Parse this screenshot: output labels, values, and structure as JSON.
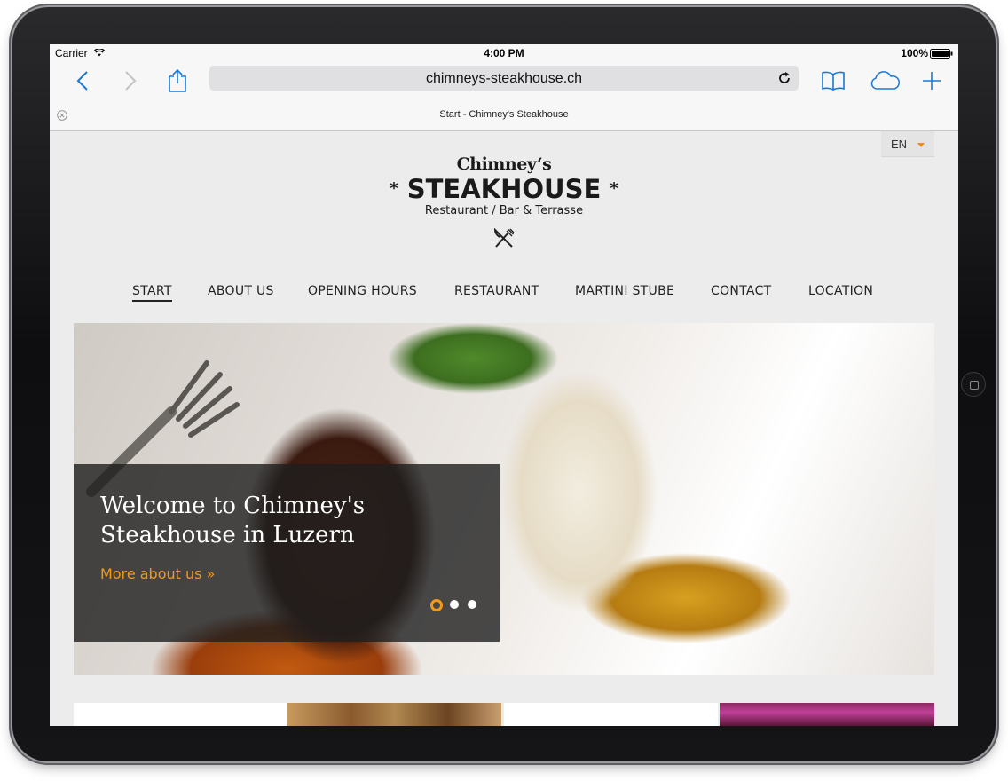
{
  "status": {
    "carrier": "Carrier",
    "time": "4:00 PM",
    "battery": "100%"
  },
  "browser": {
    "url": "chimneys-steakhouse.ch",
    "tab_title": "Start - Chimney's Steakhouse"
  },
  "site": {
    "language": "EN",
    "logo": {
      "top": "Chimney‘s",
      "main": "STEAKHOUSE",
      "star": "*",
      "sub": "Restaurant / Bar & Terrasse"
    },
    "nav": [
      {
        "label": "START",
        "active": true
      },
      {
        "label": "ABOUT US"
      },
      {
        "label": "OPENING HOURS"
      },
      {
        "label": "RESTAURANT"
      },
      {
        "label": "MARTINI STUBE"
      },
      {
        "label": "CONTACT"
      },
      {
        "label": "LOCATION"
      }
    ],
    "hero": {
      "title": "Welcome to Chimney's Steakhouse in Luzern",
      "link": "More about us »",
      "slide_count": 3,
      "active_slide": 1
    }
  },
  "colors": {
    "accent": "#f39a1a",
    "browser_blue": "#1a78d6"
  }
}
